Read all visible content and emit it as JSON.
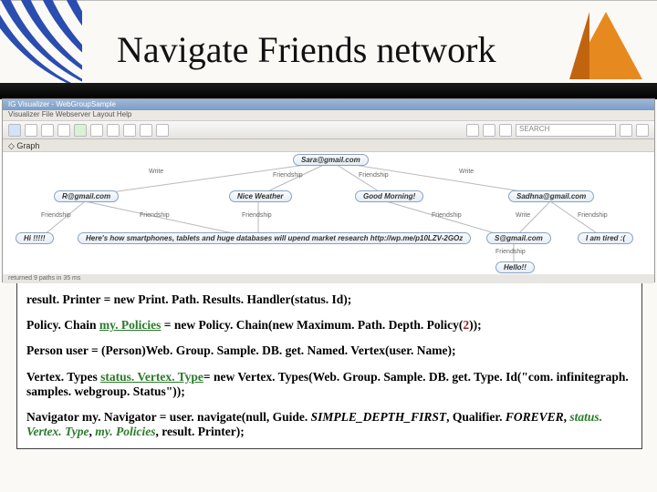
{
  "slide": {
    "title": "Navigate Friends network"
  },
  "viz": {
    "window_title": "IG Visualizer - WebGroupSample",
    "menubar": "Visualizer  File  Webserver  Layout  Help",
    "tab_label": "Graph",
    "search_placeholder": "SEARCH",
    "statusbar": "returned 9 paths in 35 ms",
    "nodes": {
      "sara": "Sara@gmail.com",
      "r": "R@gmail.com",
      "nice": "Nice Weather",
      "good": "Good Morning!",
      "sadhna": "Sadhna@gmail.com",
      "hi": "Hi !!!!!",
      "smart": "Here's how smartphones, tablets and huge databases will upend market research http://wp.me/p10LZV-2GOz",
      "s": "S@gmail.com",
      "tired": "I am tired :(",
      "hello": "Hello!!"
    },
    "edgelabels": {
      "write": "Write",
      "friendship": "Friendship"
    }
  },
  "code": {
    "l1_a": "result. Printer = new Print. Path. Results. Handler(status. Id);",
    "l2_a": "Policy. Chain ",
    "l2_b": "my. Policies",
    "l2_c": " = new Policy. Chain(new Maximum. Path. Depth. Policy(",
    "l2_d": "2",
    "l2_e": "));",
    "l3_a": "Person user = (Person)Web. Group. Sample. DB. get. Named. Vertex(user. Name);",
    "l4_a": "Vertex. Types ",
    "l4_b": "status. Vertex. Type",
    "l4_c": "= new Vertex. Types(Web. Group. Sample. DB. get. Type. Id(\"com. infinitegraph. samples. webgroup. Status\"));",
    "l5_a": "Navigator my. Navigator = user. navigate(null, Guide. ",
    "l5_b": "SIMPLE_DEPTH_FIRST",
    "l5_c": ", Qualifier. ",
    "l5_d": "FOREVER",
    "l5_e": ", ",
    "l5_f": "status. Vertex. Type",
    "l5_g": ", ",
    "l5_h": "my. Policies",
    "l5_i": ", result. Printer);"
  }
}
